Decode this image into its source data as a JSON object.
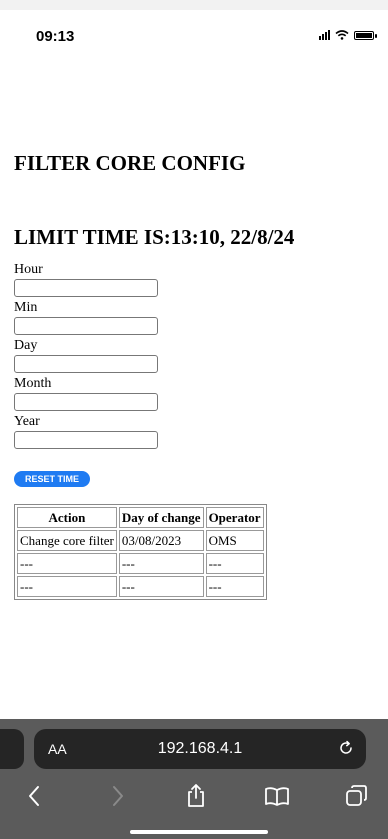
{
  "status_bar": {
    "time": "09:13"
  },
  "page": {
    "title": "FILTER CORE CONFIG",
    "limit_time": "LIMIT TIME IS:13:10, 22/8/24"
  },
  "form": {
    "fields": [
      {
        "label": "Hour",
        "value": ""
      },
      {
        "label": "Min",
        "value": ""
      },
      {
        "label": "Day",
        "value": ""
      },
      {
        "label": "Month",
        "value": ""
      },
      {
        "label": "Year",
        "value": ""
      }
    ],
    "reset_button": "RESET TIME"
  },
  "table": {
    "headers": [
      "Action",
      "Day of change",
      "Operator"
    ],
    "rows": [
      [
        "Change core filter",
        "03/08/2023",
        "OMS"
      ],
      [
        "---",
        "---",
        "---"
      ],
      [
        "---",
        "---",
        "---"
      ]
    ]
  },
  "browser": {
    "aa_label": "AA",
    "url": "192.168.4.1",
    "icons": [
      "back-icon",
      "forward-icon",
      "share-icon",
      "bookmarks-icon",
      "tabs-icon",
      "reload-icon"
    ]
  },
  "colors": {
    "button_blue": "#1f7bf2",
    "toolbar_gray": "#5b5b5b",
    "pill_dark": "#252525"
  }
}
